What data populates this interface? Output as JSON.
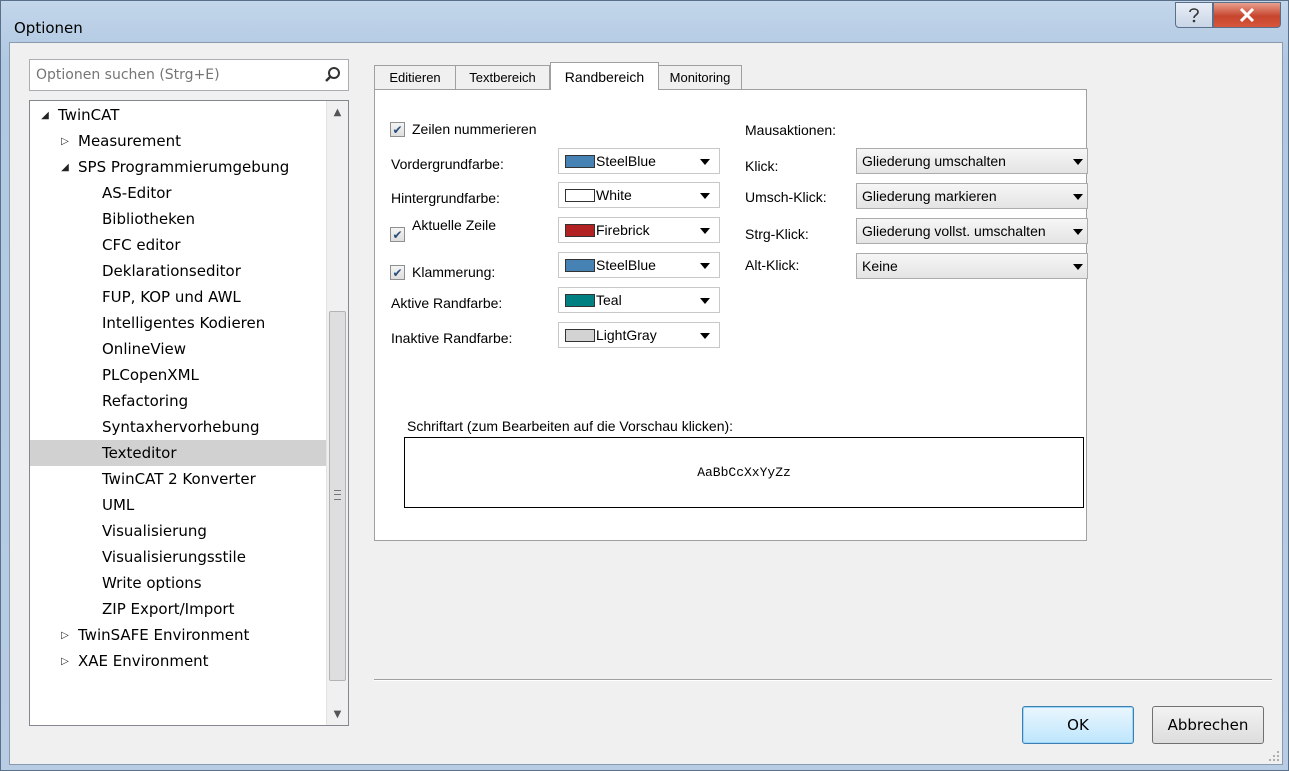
{
  "window": {
    "title": "Optionen"
  },
  "search": {
    "placeholder": "Optionen suchen (Strg+E)"
  },
  "tree": [
    {
      "label": "TwinCAT",
      "level": 0,
      "expander": "expanded"
    },
    {
      "label": "Measurement",
      "level": 1,
      "expander": "collapsed"
    },
    {
      "label": "SPS Programmierumgebung",
      "level": 1,
      "expander": "expanded"
    },
    {
      "label": "AS-Editor",
      "level": 2
    },
    {
      "label": "Bibliotheken",
      "level": 2
    },
    {
      "label": "CFC editor",
      "level": 2
    },
    {
      "label": "Deklarationseditor",
      "level": 2
    },
    {
      "label": "FUP, KOP und AWL",
      "level": 2
    },
    {
      "label": "Intelligentes Kodieren",
      "level": 2
    },
    {
      "label": "OnlineView",
      "level": 2
    },
    {
      "label": "PLCopenXML",
      "level": 2
    },
    {
      "label": "Refactoring",
      "level": 2
    },
    {
      "label": "Syntaxhervorhebung",
      "level": 2
    },
    {
      "label": "Texteditor",
      "level": 2,
      "selected": true
    },
    {
      "label": "TwinCAT 2 Konverter",
      "level": 2
    },
    {
      "label": "UML",
      "level": 2
    },
    {
      "label": "Visualisierung",
      "level": 2
    },
    {
      "label": "Visualisierungsstile",
      "level": 2
    },
    {
      "label": "Write options",
      "level": 2
    },
    {
      "label": "ZIP Export/Import",
      "level": 2
    },
    {
      "label": "TwinSAFE Environment",
      "level": 1,
      "expander": "collapsed"
    },
    {
      "label": "XAE Environment",
      "level": 1,
      "expander": "collapsed"
    }
  ],
  "tabs": [
    {
      "label": "Editieren"
    },
    {
      "label": "Textbereich"
    },
    {
      "label": "Randbereich",
      "active": true
    },
    {
      "label": "Monitoring"
    }
  ],
  "randbereich": {
    "zeilen_nummerieren": {
      "label": "Zeilen nummerieren",
      "checked": true
    },
    "vordergrund": {
      "label": "Vordergrundfarbe:",
      "value": "SteelBlue",
      "color": "#4682b4"
    },
    "hintergrund": {
      "label": "Hintergrundfarbe:",
      "value": "White",
      "color": "#ffffff"
    },
    "aktuelle_zeile": {
      "label": "Aktuelle Zeile",
      "checked": true,
      "value": "Firebrick",
      "color": "#b22222"
    },
    "klammerung": {
      "label": "Klammerung:",
      "checked": true,
      "value": "SteelBlue",
      "color": "#4682b4"
    },
    "aktive_rand": {
      "label": "Aktive Randfarbe:",
      "value": "Teal",
      "color": "#008080"
    },
    "inaktive_rand": {
      "label": "Inaktive Randfarbe:",
      "value": "LightGray",
      "color": "#d3d3d3"
    },
    "mausaktionen": {
      "title": "Mausaktionen:",
      "klick": {
        "label": "Klick:",
        "value": "Gliederung umschalten"
      },
      "umsch_klick": {
        "label": "Umsch-Klick:",
        "value": "Gliederung markieren"
      },
      "strg_klick": {
        "label": "Strg-Klick:",
        "value": "Gliederung vollst. umschalten"
      },
      "alt_klick": {
        "label": "Alt-Klick:",
        "value": "Keine"
      }
    },
    "schriftart": {
      "label": "Schriftart (zum Bearbeiten auf die Vorschau klicken):",
      "preview": "AaBbCcXxYyZz"
    }
  },
  "buttons": {
    "ok": "OK",
    "cancel": "Abbrechen"
  }
}
